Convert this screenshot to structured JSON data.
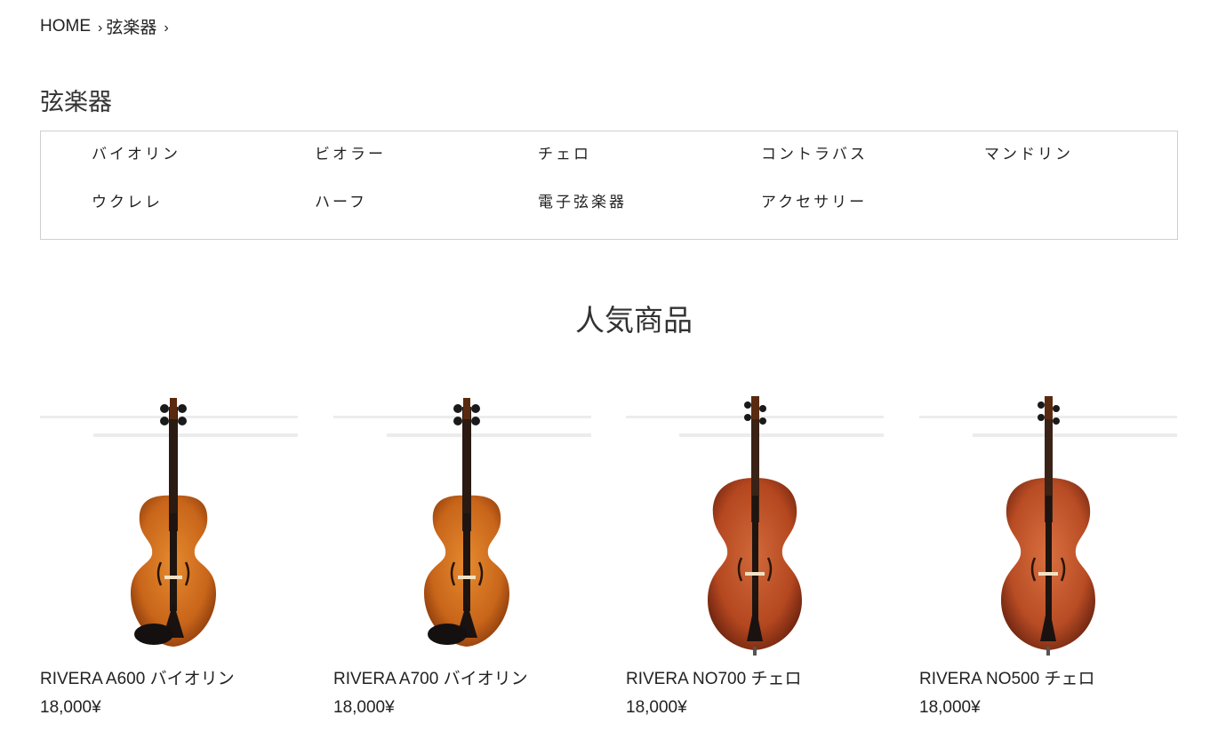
{
  "breadcrumb": {
    "items": [
      "HOME",
      "弦楽器"
    ],
    "separator": "›"
  },
  "page_title": "弦楽器",
  "subcategories": [
    "バイオリン",
    "ビオラー",
    "チェロ",
    "コントラバス",
    "マンドリン",
    "ウクレレ",
    "ハーフ",
    "電子弦楽器",
    "アクセサリー"
  ],
  "section_title": "人気商品",
  "products": [
    {
      "name": "RIVERA A600 バイオリン",
      "price": "18,000¥",
      "image": "violin-image"
    },
    {
      "name": "RIVERA A700 バイオリン",
      "price": "18,000¥",
      "image": "violin-image"
    },
    {
      "name": "RIVERA NO700 チェロ",
      "price": "18,000¥",
      "image": "cello-image"
    },
    {
      "name": "RIVERA NO500 チェロ",
      "price": "18,000¥",
      "image": "cello-image"
    }
  ],
  "colors": {
    "text": "#222222",
    "border": "#cfcfcf",
    "violin_body": "#c8651a",
    "cello_body": "#b4471f"
  }
}
